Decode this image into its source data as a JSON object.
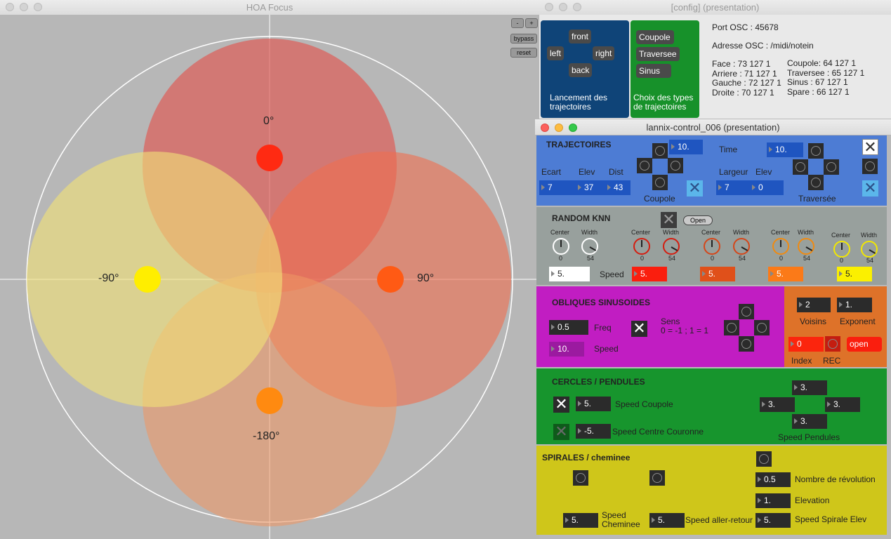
{
  "hoa": {
    "title": "HOA Focus",
    "zoom_minus": "-",
    "zoom_plus": "+",
    "bypass": "bypass",
    "reset": "reset",
    "labels": {
      "top": "0°",
      "left": "-90°",
      "right": "90°",
      "bottom": "-180°"
    },
    "colors": {
      "red": "#ff2a12",
      "orange": "#ff5a14",
      "orange2": "#ff8a10",
      "yellow": "#ffee00"
    }
  },
  "config": {
    "title": "[config] (presentation)",
    "dir_buttons": {
      "front": "front",
      "left": "left",
      "right": "right",
      "back": "back"
    },
    "dir_caption": "Lancement des trajectoires",
    "type_buttons": {
      "coupole": "Coupole",
      "traversee": "Traversee",
      "sinus": "Sinus"
    },
    "type_caption": "Choix des types de trajectoires",
    "port": "Port OSC : 45678",
    "address": "Adresse OSC : /midi/notein",
    "face": "Face : 73 127 1",
    "arriere": "Arriere : 71 127 1",
    "gauche": "Gauche : 72 127 1",
    "droite": "Droite : 70 127 1",
    "coupole": "Coupole: 64 127 1",
    "traversee": "Traversee : 65 127 1",
    "sinus": "Sinus : 67 127 1",
    "spare": "Spare : 66 127 1"
  },
  "ctrl": {
    "title": "lannix-control_006 (presentation)",
    "traj": {
      "heading": "TRAJECTOIRES",
      "ecart": "Ecart",
      "elev": "Elev",
      "dist": "Dist",
      "ecart_val": "7",
      "elev_val": "37",
      "dist_val": "43",
      "coupole_time": "10.",
      "coupole": "Coupole",
      "time": "Time",
      "time_val": "10.",
      "largeur": "Largeur",
      "elev2": "Elev",
      "largeur_val": "7",
      "elev2_val": "0",
      "traversee": "Traversée",
      "x": "✕"
    },
    "knn": {
      "heading": "RANDOM KNN",
      "open": "Open",
      "center": "Center",
      "width": "Width",
      "center_val": "0",
      "width_val": "54",
      "speed": "Speed",
      "speeds": [
        "5.",
        "5.",
        "5.",
        "5.",
        "5."
      ]
    },
    "obl": {
      "heading": "OBLIQUES SINUSOIDES",
      "freq_val": "0.5",
      "freq": "Freq",
      "speed_val": "10.",
      "speed": "Speed",
      "sens": "Sens",
      "sens_desc": "0 = -1 ;  1 = 1",
      "voisins_val": "2",
      "voisins": "Voisins",
      "exponent_val": "1.",
      "exponent": "Exponent",
      "index_val": "0",
      "index": "Index",
      "rec": "REC",
      "open": "open"
    },
    "cercles": {
      "heading": "CERCLES / PENDULES",
      "coupole_val": "5.",
      "coupole": "Speed Coupole",
      "centre_val": "-5.",
      "centre": "Speed Centre Couronne",
      "p_top": "3.",
      "p_left": "3.",
      "p_right": "3.",
      "p_bottom": "3.",
      "pendules": "Speed Pendules"
    },
    "spirales": {
      "heading": "SPIRALES / cheminee",
      "revol_val": "0.5",
      "revol": "Nombre de révolution",
      "elev_val": "1.",
      "elev": "Elevation",
      "chem_val": "5.",
      "chem": "Speed Cheminee",
      "ar_val": "5.",
      "ar": "Speed aller-retour",
      "sp_val": "5.",
      "sp": "Speed Spirale Elev"
    }
  }
}
